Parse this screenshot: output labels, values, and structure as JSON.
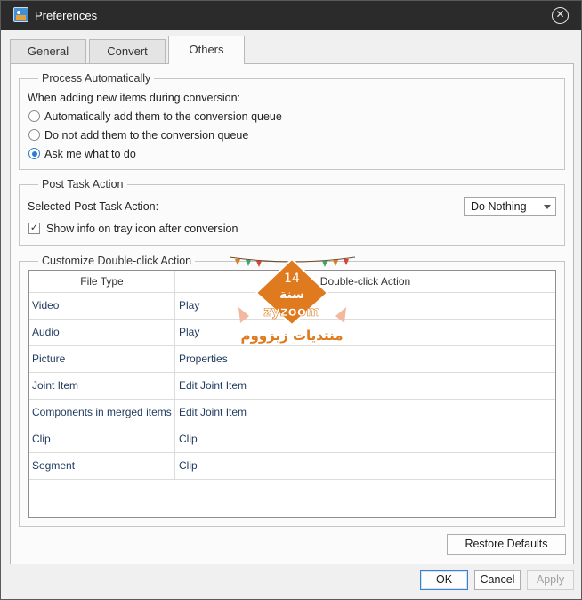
{
  "window": {
    "title": "Preferences"
  },
  "tabs": [
    {
      "label": "General",
      "active": false
    },
    {
      "label": "Convert",
      "active": false
    },
    {
      "label": "Others",
      "active": true
    }
  ],
  "process_automatically": {
    "title": "Process Automatically",
    "prompt": "When adding new items during conversion:",
    "options": [
      {
        "label": "Automatically add them to the conversion queue",
        "checked": false
      },
      {
        "label": "Do not add them to the conversion queue",
        "checked": false
      },
      {
        "label": "Ask me what to do",
        "checked": true
      }
    ]
  },
  "post_task": {
    "title": "Post Task Action",
    "label": "Selected Post Task Action:",
    "selected": "Do Nothing",
    "show_tray_info": {
      "label": "Show info on tray icon after conversion",
      "checked": true
    }
  },
  "double_click": {
    "title": "Customize Double-click Action",
    "columns": [
      "File Type",
      "Double-click Action"
    ],
    "rows": [
      {
        "type": "Video",
        "action": "Play"
      },
      {
        "type": "Audio",
        "action": "Play"
      },
      {
        "type": "Picture",
        "action": "Properties"
      },
      {
        "type": "Joint Item",
        "action": "Edit Joint Item"
      },
      {
        "type": "Components in merged items",
        "action": "Edit Joint Item"
      },
      {
        "type": "Clip",
        "action": "Clip"
      },
      {
        "type": "Segment",
        "action": "Clip"
      }
    ]
  },
  "buttons": {
    "restore": "Restore Defaults",
    "ok": "OK",
    "cancel": "Cancel",
    "apply": "Apply"
  },
  "watermark": {
    "badge_number": "14",
    "badge_text": "سنة",
    "brand": "zyzoom",
    "arabic": "منتديات زيزووم"
  },
  "colors": {
    "titlebar": "#2b2b2b",
    "accent": "#2f7ad3",
    "watermark_orange": "#e07a1e"
  }
}
